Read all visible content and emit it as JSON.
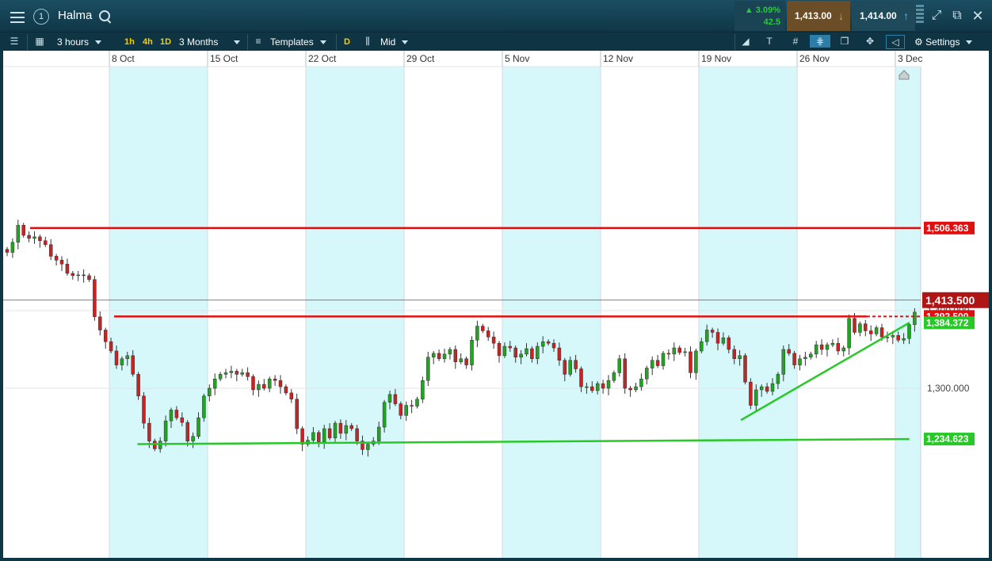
{
  "header": {
    "instrument": "Halma",
    "account_badge": "1",
    "change_pct": "▲ 3.09%",
    "change_abs": "42.5",
    "sell_price": "1,413.00",
    "buy_price": "1,414.00"
  },
  "toolbar": {
    "interval": "3 hours",
    "timeframes": [
      "1h",
      "4h",
      "1D"
    ],
    "range": "3 Months",
    "templates": "Templates",
    "d_badge": "D",
    "price_type": "Mid",
    "settings": "Settings",
    "text_tool": "T"
  },
  "chart_data": {
    "type": "candlestick",
    "x_labels": [
      "8 Oct",
      "15 Oct",
      "22 Oct",
      "29 Oct",
      "5 Nov",
      "12 Nov",
      "19 Nov",
      "26 Nov",
      "3 Dec"
    ],
    "y_ticks": [
      "1,400.000",
      "1,300.000"
    ],
    "ylim": [
      1224,
      1428
    ],
    "current_price": "1,413.500",
    "horizontal_lines": [
      {
        "label": "1,506.363",
        "value": 1506.363,
        "color": "#e01010"
      },
      {
        "label": "1,392.500",
        "value": 1392.5,
        "color": "#e01010"
      }
    ],
    "trendlines": [
      {
        "name": "support",
        "label": "1,234.623",
        "from": {
          "date": "2018-10-10",
          "value": 1228
        },
        "to": {
          "date": "2018-12-04",
          "value": 1234.623
        },
        "color": "#28c828"
      },
      {
        "name": "rising",
        "label": "1,384.372",
        "from": {
          "date": "2018-11-22",
          "value": 1259
        },
        "to": {
          "date": "2018-12-04",
          "value": 1384.372
        },
        "color": "#28c828"
      }
    ],
    "up_color": "#21a421",
    "down_color": "#c72323",
    "closes": [
      1475,
      1488,
      1510,
      1497,
      1493,
      1495,
      1490,
      1485,
      1470,
      1465,
      1460,
      1448,
      1445,
      1446,
      1445,
      1440,
      1392,
      1375,
      1360,
      1348,
      1330,
      1338,
      1342,
      1318,
      1290,
      1255,
      1232,
      1222,
      1232,
      1258,
      1272,
      1262,
      1256,
      1232,
      1238,
      1262,
      1290,
      1300,
      1312,
      1318,
      1320,
      1322,
      1318,
      1320,
      1315,
      1298,
      1305,
      1300,
      1312,
      1310,
      1302,
      1294,
      1286,
      1248,
      1228,
      1233,
      1243,
      1231,
      1248,
      1236,
      1255,
      1242,
      1252,
      1248,
      1232,
      1221,
      1228,
      1232,
      1250,
      1282,
      1292,
      1280,
      1265,
      1278,
      1277,
      1286,
      1310,
      1340,
      1345,
      1338,
      1344,
      1350,
      1334,
      1338,
      1330,
      1362,
      1380,
      1374,
      1366,
      1358,
      1342,
      1354,
      1352,
      1340,
      1344,
      1351,
      1338,
      1354,
      1360,
      1358,
      1352,
      1336,
      1318,
      1336,
      1325,
      1302,
      1302,
      1297,
      1306,
      1300,
      1310,
      1320,
      1338,
      1300,
      1298,
      1302,
      1312,
      1326,
      1336,
      1329,
      1345,
      1344,
      1352,
      1346,
      1347,
      1320,
      1348,
      1360,
      1375,
      1372,
      1358,
      1365,
      1350,
      1338,
      1342,
      1308,
      1278,
      1298,
      1302,
      1296,
      1306,
      1318,
      1350,
      1345,
      1330,
      1338,
      1340,
      1344,
      1356,
      1350,
      1356,
      1358,
      1348,
      1352,
      1390,
      1372,
      1383,
      1374,
      1370,
      1378,
      1366,
      1366,
      1368,
      1362,
      1364,
      1382,
      1398
    ]
  }
}
